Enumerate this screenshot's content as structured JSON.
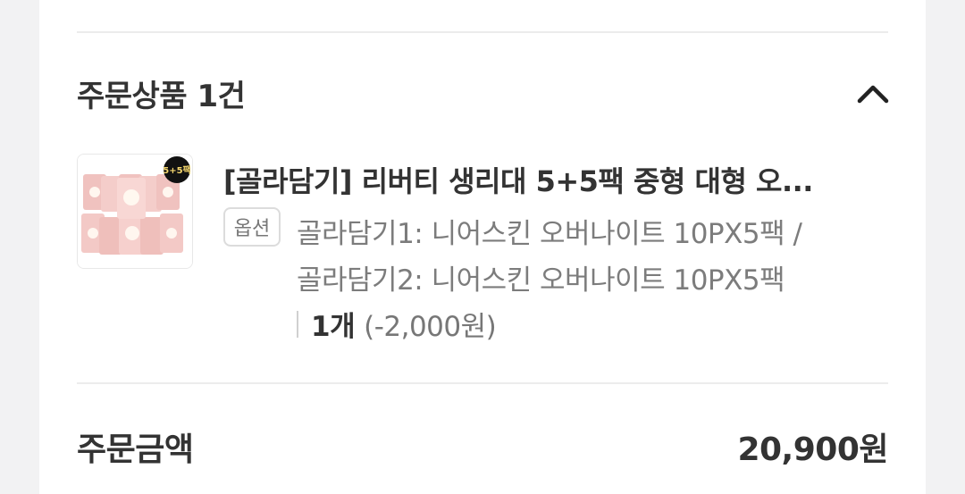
{
  "order_products": {
    "title": "주문상품 1건",
    "collapse_icon": "chevron-up-icon"
  },
  "product": {
    "name": "[골라담기] 리버티 생리대 5+5팩 중형 대형 오...",
    "thumbnail_badge": "5+5팩",
    "option_label": "옵션",
    "option_line1": "골라담기1: 니어스킨 오버나이트 10PX5팩 /",
    "option_line2": "골라담기2: 니어스킨 오버나이트 10PX5팩",
    "quantity": "1개",
    "discount": "(-2,000원)"
  },
  "order_total": {
    "label": "주문금액",
    "value": "20,900원"
  },
  "colors": {
    "accent_pink": "#f3c9c6",
    "badge_black": "#111111"
  }
}
